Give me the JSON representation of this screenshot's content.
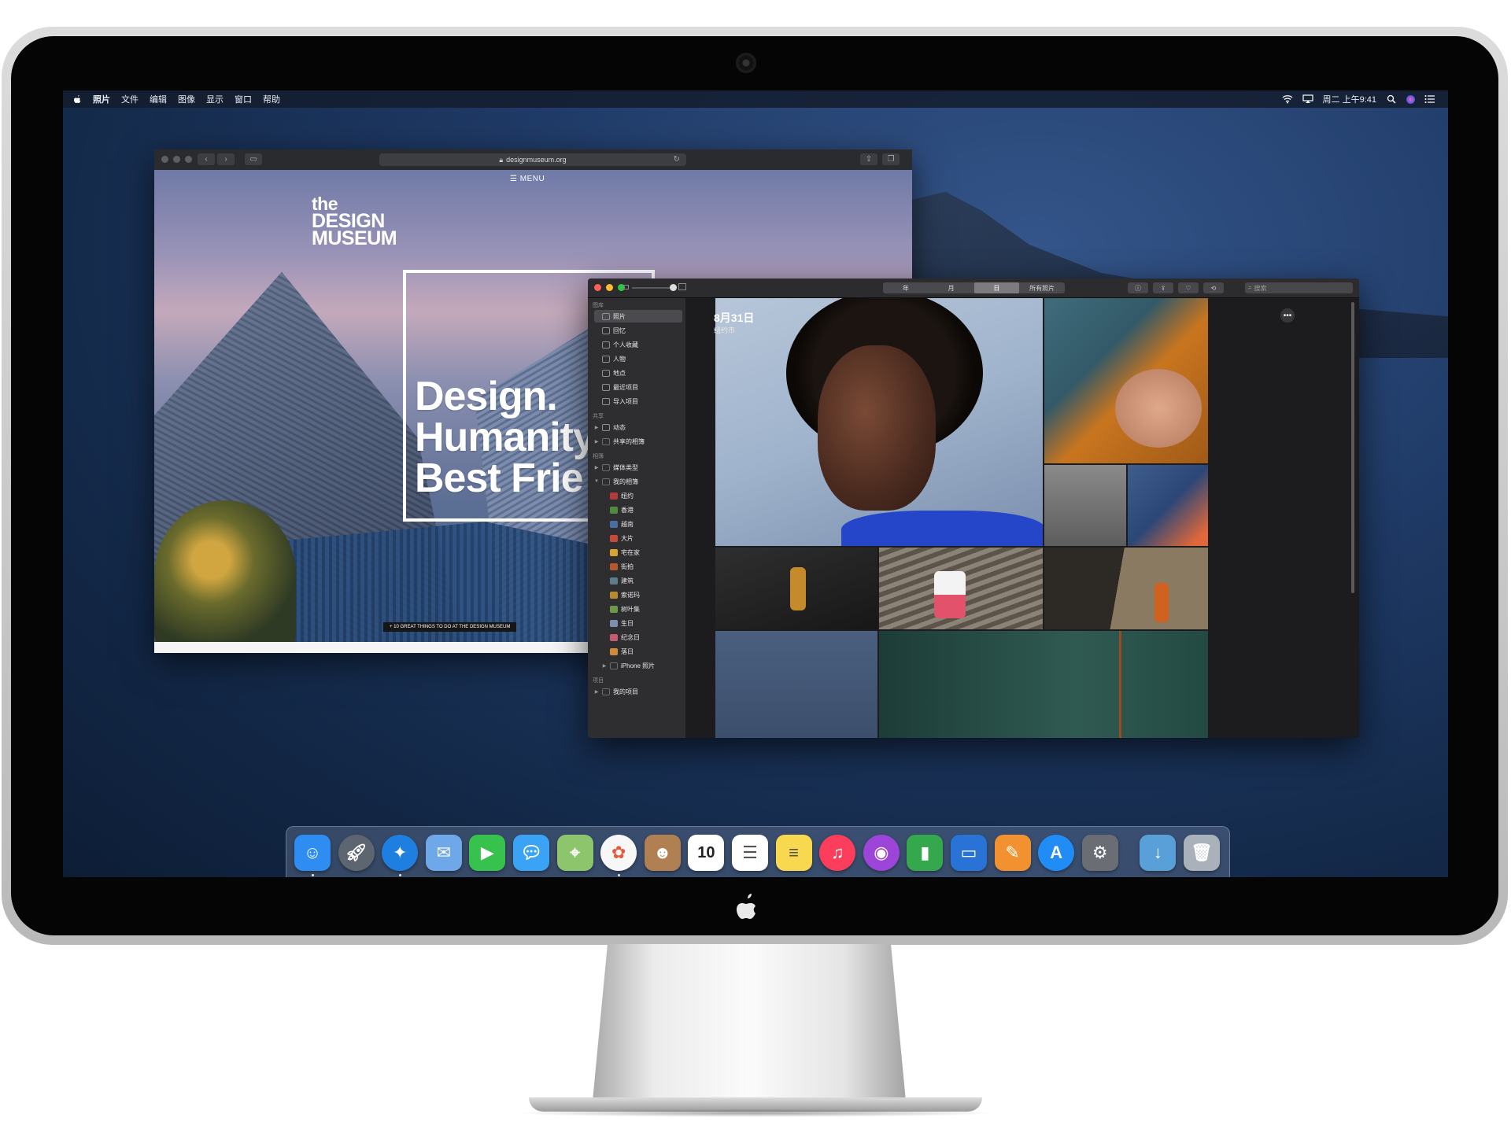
{
  "menubar": {
    "app_name": "照片",
    "items": [
      "文件",
      "编辑",
      "图像",
      "显示",
      "窗口",
      "帮助"
    ],
    "clock": "周二 上午9:41"
  },
  "browser": {
    "url": "designmuseum.org",
    "menu_label": "MENU",
    "logo": [
      "the",
      "DESIGN",
      "MUSEUM"
    ],
    "headline": [
      "Design.",
      "Humanity",
      "Best Frie"
    ],
    "cta": "+ 10 GREAT THINGS TO DO AT THE DESIGN MUSEUM"
  },
  "photos": {
    "view_tabs": [
      {
        "label": "年",
        "active": false
      },
      {
        "label": "月",
        "active": false
      },
      {
        "label": "日",
        "active": true
      },
      {
        "label": "所有照片",
        "active": false
      }
    ],
    "search_placeholder": "搜索",
    "day_title": "8月31日",
    "day_location": "纽约市",
    "sidebar": {
      "sections": [
        {
          "header": "图库",
          "items": [
            {
              "label": "照片",
              "icon": "photos-icon",
              "selected": true
            },
            {
              "label": "回忆",
              "icon": "memories-icon"
            },
            {
              "label": "个人收藏",
              "icon": "heart-icon"
            },
            {
              "label": "人物",
              "icon": "person-icon"
            },
            {
              "label": "地点",
              "icon": "pin-icon"
            },
            {
              "label": "最近项目",
              "icon": "clock-icon"
            },
            {
              "label": "导入项目",
              "icon": "import-icon"
            }
          ]
        },
        {
          "header": "共享",
          "items": [
            {
              "label": "动态",
              "icon": "cloud-icon",
              "disclosure": true
            },
            {
              "label": "共享的相簿",
              "icon": "folder-icon",
              "disclosure": true
            }
          ]
        },
        {
          "header": "相簿",
          "items": [
            {
              "label": "媒体类型",
              "icon": "folder-icon",
              "disclosure": true
            },
            {
              "label": "我的相簿",
              "icon": "folder-icon",
              "disclosure": true,
              "expanded": true
            },
            {
              "label": "纽约",
              "icon": "album-icon",
              "indent": 1
            },
            {
              "label": "香港",
              "icon": "album-icon",
              "indent": 1
            },
            {
              "label": "越南",
              "icon": "album-icon",
              "indent": 1
            },
            {
              "label": "大片",
              "icon": "album-icon",
              "indent": 1
            },
            {
              "label": "宅在家",
              "icon": "album-icon",
              "indent": 1
            },
            {
              "label": "街拍",
              "icon": "album-icon",
              "indent": 1
            },
            {
              "label": "建筑",
              "icon": "album-icon",
              "indent": 1
            },
            {
              "label": "索诺玛",
              "icon": "album-icon",
              "indent": 1
            },
            {
              "label": "树叶集",
              "icon": "album-icon",
              "indent": 1
            },
            {
              "label": "生日",
              "icon": "album-icon",
              "indent": 1
            },
            {
              "label": "纪念日",
              "icon": "album-icon",
              "indent": 1
            },
            {
              "label": "落日",
              "icon": "album-icon",
              "indent": 1
            },
            {
              "label": "iPhone 照片",
              "icon": "folder-icon",
              "indent": 1,
              "disclosure": true
            }
          ]
        },
        {
          "header": "项目",
          "items": [
            {
              "label": "我的项目",
              "icon": "folder-icon",
              "disclosure": true
            }
          ]
        }
      ]
    }
  },
  "dock": {
    "apps": [
      {
        "name": "finder-icon",
        "color": "#2f8cf0",
        "running": true
      },
      {
        "name": "launchpad-icon",
        "color": "#5c6570"
      },
      {
        "name": "safari-icon",
        "color": "#1f7fe0",
        "running": true
      },
      {
        "name": "mail-icon",
        "color": "#6fa8e8"
      },
      {
        "name": "facetime-icon",
        "color": "#37c24d"
      },
      {
        "name": "messages-icon",
        "color": "#3aa3f5"
      },
      {
        "name": "maps-icon",
        "color": "#8cc56b"
      },
      {
        "name": "photos-app-icon",
        "color": "#f7f7f7",
        "running": true
      },
      {
        "name": "contacts-icon",
        "color": "#b08052"
      },
      {
        "name": "calendar-icon",
        "color": "#ffffff",
        "text": "10"
      },
      {
        "name": "reminders-icon",
        "color": "#ffffff"
      },
      {
        "name": "notes-icon",
        "color": "#f7d84f"
      },
      {
        "name": "music-icon",
        "color": "#fc3d5b"
      },
      {
        "name": "podcasts-icon",
        "color": "#9c45d8"
      },
      {
        "name": "numbers-icon",
        "color": "#35a84d"
      },
      {
        "name": "keynote-icon",
        "color": "#2a73d6"
      },
      {
        "name": "pages-icon",
        "color": "#f2912f"
      },
      {
        "name": "app-store-icon",
        "color": "#1f8df5"
      },
      {
        "name": "system-preferences-icon",
        "color": "#6a6e74"
      },
      {
        "name": "downloads-folder-icon",
        "color": "#5aa0d8"
      },
      {
        "name": "trash-icon",
        "color": "#a9b2bb"
      }
    ]
  },
  "colors": {
    "desktop": "#1f3a66",
    "accent": "#2f8cf0",
    "close": "#ff5f57",
    "minimize": "#febc2e",
    "zoom": "#28c840"
  }
}
